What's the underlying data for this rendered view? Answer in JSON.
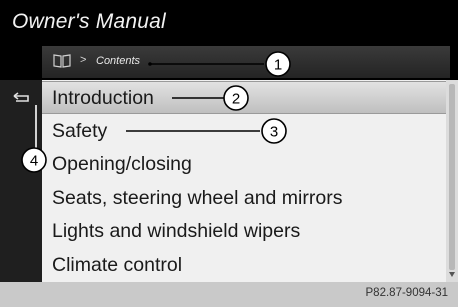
{
  "header": {
    "title": "Owner's Manual"
  },
  "breadcrumb": {
    "icon": "book-icon",
    "separator": ">",
    "current": "Contents"
  },
  "back_button": {
    "icon": "back-arrow-icon"
  },
  "menu": {
    "items": [
      {
        "label": "Introduction",
        "selected": true
      },
      {
        "label": "Safety"
      },
      {
        "label": "Opening/closing"
      },
      {
        "label": "Seats, steering wheel and mirrors"
      },
      {
        "label": "Lights and windshield wipers"
      },
      {
        "label": "Climate control"
      }
    ]
  },
  "callouts": [
    "1",
    "2",
    "3",
    "4"
  ],
  "footer": {
    "ref": "P82.87-9094-31"
  },
  "colors": {
    "screen_bg": "#000000",
    "menu_bg": "#f0f0f0",
    "selection": "#c8c8c8",
    "page_bg": "#c9c9c9"
  }
}
